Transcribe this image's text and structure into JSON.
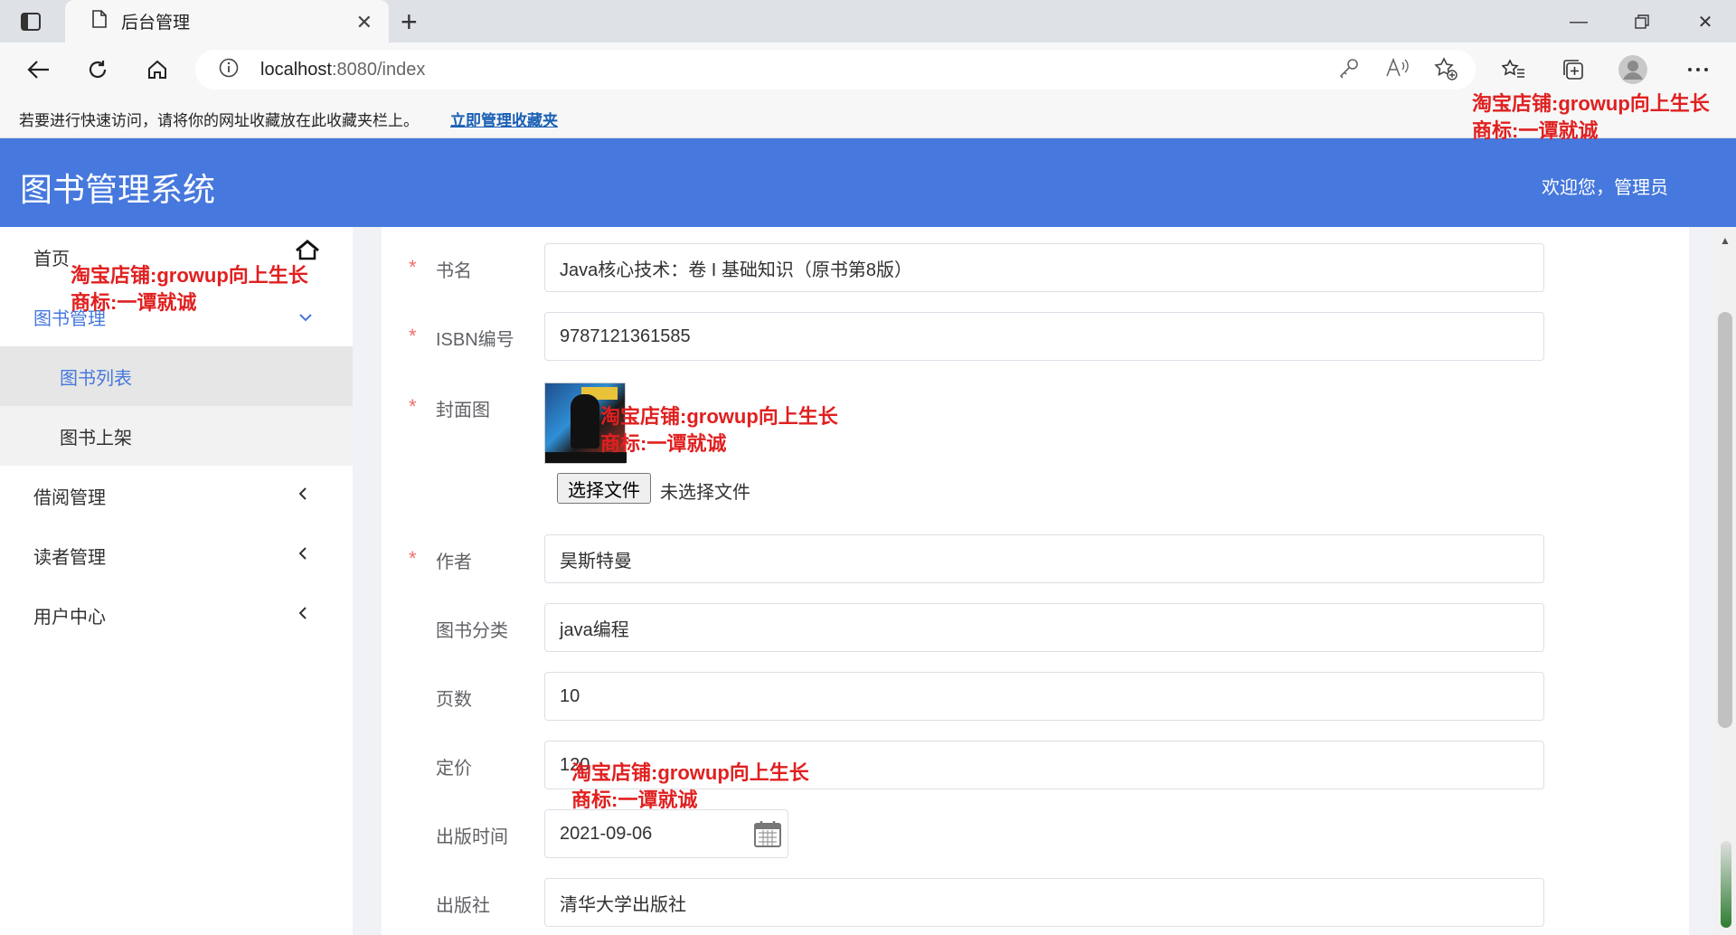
{
  "browser": {
    "tab_title": "后台管理",
    "address": "localhost",
    "address_rest": ":8080/index",
    "favorites_hint": "若要进行快速访问，请将你的网址收藏放在此收藏夹栏上。",
    "favorites_link": "立即管理收藏夹"
  },
  "header": {
    "title": "图书管理系统",
    "welcome": "欢迎您，管理员"
  },
  "sidebar": {
    "items": [
      {
        "label": "首页"
      },
      {
        "label": "图书管理"
      },
      {
        "label": "图书列表"
      },
      {
        "label": "图书上架"
      },
      {
        "label": "借阅管理"
      },
      {
        "label": "读者管理"
      },
      {
        "label": "用户中心"
      }
    ]
  },
  "form": {
    "title_label": "书名",
    "title_value": "Java核心技术：卷 I 基础知识（原书第8版）",
    "isbn_label": "ISBN编号",
    "isbn_value": "9787121361585",
    "cover_label": "封面图",
    "file_button": "选择文件",
    "file_none": "未选择文件",
    "author_label": "作者",
    "author_value": "昊斯特曼",
    "category_label": "图书分类",
    "category_value": "java编程",
    "pages_label": "页数",
    "pages_value": "10",
    "price_label": "定价",
    "price_value": "120",
    "pubdate_label": "出版时间",
    "pubdate_value": "2021-09-06",
    "publisher_label": "出版社",
    "publisher_value": "清华大学出版社",
    "required_mark": "*"
  },
  "watermark": {
    "line1": "淘宝店铺:growup向上生长",
    "line2": "商标:一谭就诚"
  },
  "colors": {
    "header_bg": "#4678dd",
    "accent": "#4678dd",
    "required": "#f56c6c",
    "watermark": "#e02020"
  }
}
